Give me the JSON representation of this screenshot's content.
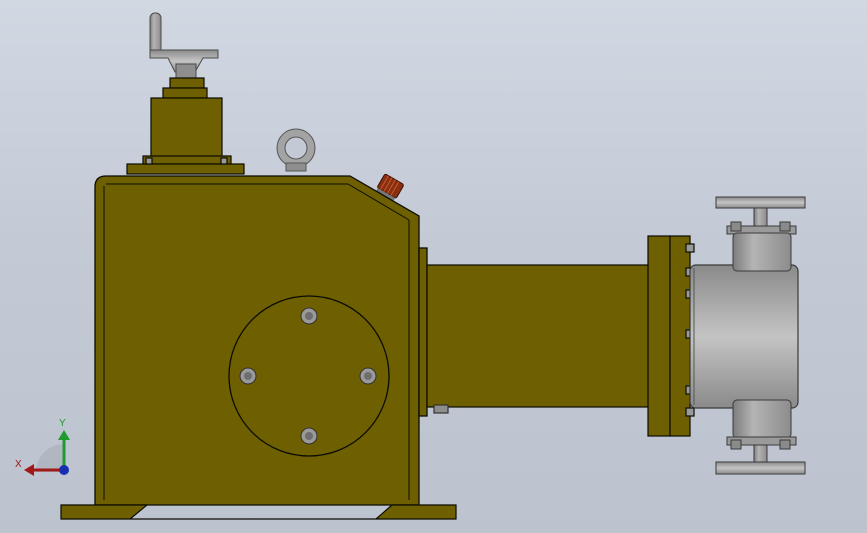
{
  "triad": {
    "x_label": "X",
    "y_label": "Y",
    "x_color": "#a01818",
    "y_color": "#1f9a2c",
    "z_color": "#1a2fb0"
  },
  "colors": {
    "body_fill": "#6e6000",
    "body_edge": "#0b0b00",
    "steel_fill": "#9a9a9a",
    "steel_dark": "#6e6e6e",
    "knob_fill": "#8a2e10",
    "background_top": "#d2d8e2",
    "background_bottom": "#bcc3cf"
  },
  "parts": [
    "handwheel-icon",
    "adjuster-housing",
    "lifting-eye-icon",
    "breather-cap-icon",
    "gearbox-body",
    "bearing-cover",
    "plunger-tube",
    "mounting-flange",
    "pump-head",
    "discharge-flange",
    "suction-flange",
    "base-plate"
  ]
}
